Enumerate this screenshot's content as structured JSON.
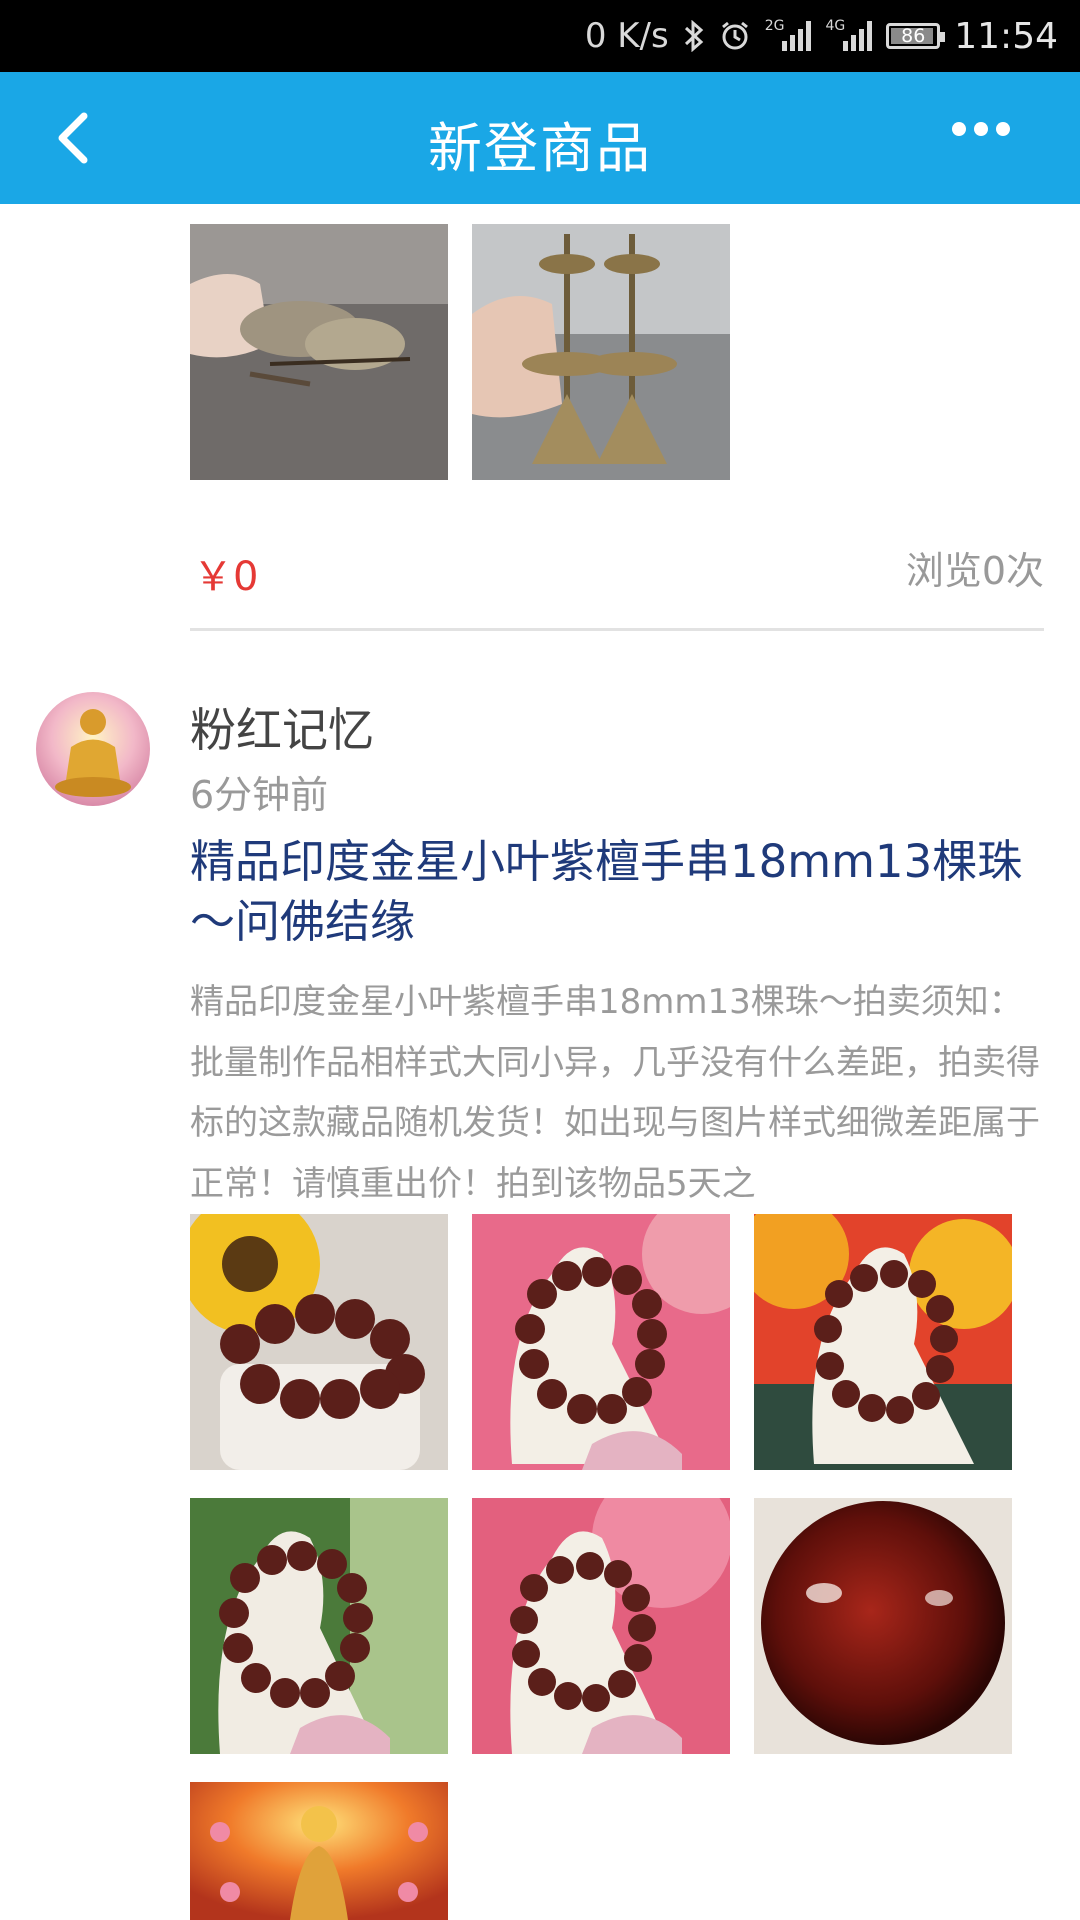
{
  "status_bar": {
    "speed": "0 K/s",
    "net1": "2G",
    "net2": "4G",
    "battery": "86",
    "time": "11:54"
  },
  "app_bar": {
    "title": "新登商品"
  },
  "prev_item": {
    "price": "￥0",
    "views": "浏览0次"
  },
  "item": {
    "username": "粉红记忆",
    "time_ago": "6分钟前",
    "title": "精品印度金星小叶紫檀手串18mm13棵珠～问佛结缘",
    "description": "精品印度金星小叶紫檀手串18mm13棵珠～拍卖须知：批量制作品相样式大同小异，几乎没有什么差距，拍卖得标的这款藏品随机发货！如出现与图片样式细微差距属于正常！请慎重出价！拍到该物品5天之"
  },
  "colors": {
    "accent": "#1aa7e6",
    "price": "#e53935",
    "title": "#1f3a7a"
  }
}
